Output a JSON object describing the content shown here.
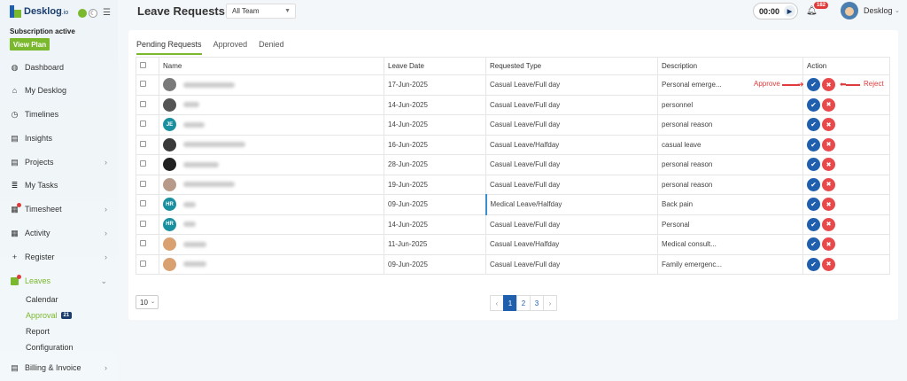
{
  "brand": {
    "name": "Desklog",
    "suffix": ".io"
  },
  "subscription": {
    "status": "Subscription active",
    "view_plan": "View Plan"
  },
  "sidebar": {
    "items": [
      {
        "label": "Dashboard",
        "icon": "palette-icon"
      },
      {
        "label": "My Desklog",
        "icon": "home-icon"
      },
      {
        "label": "Timelines",
        "icon": "clock-icon"
      },
      {
        "label": "Insights",
        "icon": "book-icon"
      },
      {
        "label": "Projects",
        "icon": "book-icon"
      },
      {
        "label": "My Tasks",
        "icon": "list-icon"
      },
      {
        "label": "Timesheet",
        "icon": "calendar-icon"
      },
      {
        "label": "Activity",
        "icon": "grid-icon"
      },
      {
        "label": "Register",
        "icon": "plus-icon"
      },
      {
        "label": "Leaves",
        "icon": "leaves-icon"
      },
      {
        "label": "Billing & Invoice",
        "icon": "invoice-icon"
      }
    ],
    "leaves_sub": [
      {
        "label": "Calendar"
      },
      {
        "label": "Approval",
        "badge": "21"
      },
      {
        "label": "Report"
      },
      {
        "label": "Configuration"
      }
    ]
  },
  "header": {
    "title": "Leave Requests",
    "team_filter": "All Team",
    "timer": "00:00",
    "notifications": "182",
    "user": "Desklog"
  },
  "tabs": [
    "Pending Requests",
    "Approved",
    "Denied"
  ],
  "table": {
    "columns": [
      "Name",
      "Leave Date",
      "Requested Type",
      "Description",
      "Action"
    ],
    "rows": [
      {
        "avatar": "photo",
        "initials": "",
        "color": "#7a7a7a",
        "date": "17-Jun-2025",
        "type": "Casual Leave/Full day",
        "medical": false,
        "desc": "Personal emerge..."
      },
      {
        "avatar": "photo",
        "initials": "",
        "color": "#555555",
        "date": "14-Jun-2025",
        "type": "Casual Leave/Full day",
        "medical": false,
        "desc": "personnel"
      },
      {
        "avatar": "initials",
        "initials": "JE",
        "color": "#1a8fa0",
        "date": "14-Jun-2025",
        "type": "Casual Leave/Full day",
        "medical": false,
        "desc": "personal reason"
      },
      {
        "avatar": "photo",
        "initials": "",
        "color": "#3a3a3a",
        "date": "16-Jun-2025",
        "type": "Casual Leave/Halfday",
        "medical": false,
        "desc": "casual leave"
      },
      {
        "avatar": "photo",
        "initials": "",
        "color": "#222222",
        "date": "28-Jun-2025",
        "type": "Casual Leave/Full day",
        "medical": false,
        "desc": "personal reason"
      },
      {
        "avatar": "photo",
        "initials": "",
        "color": "#b89a8a",
        "date": "19-Jun-2025",
        "type": "Casual Leave/Full day",
        "medical": false,
        "desc": "personal reason"
      },
      {
        "avatar": "initials",
        "initials": "HR",
        "color": "#1a8fa0",
        "date": "09-Jun-2025",
        "type": "Medical Leave/Halfday",
        "medical": true,
        "desc": "Back pain"
      },
      {
        "avatar": "initials",
        "initials": "HR",
        "color": "#1a8fa0",
        "date": "14-Jun-2025",
        "type": "Casual Leave/Full day",
        "medical": false,
        "desc": "Personal"
      },
      {
        "avatar": "photo",
        "initials": "",
        "color": "#d9a070",
        "date": "11-Jun-2025",
        "type": "Casual Leave/Halfday",
        "medical": false,
        "desc": "Medical consult..."
      },
      {
        "avatar": "photo",
        "initials": "",
        "color": "#d9a070",
        "date": "09-Jun-2025",
        "type": "Casual Leave/Full day",
        "medical": false,
        "desc": "Family emergenc..."
      }
    ]
  },
  "annotations": {
    "approve": "Approve",
    "reject": "Reject"
  },
  "pagination": {
    "per_page": "10",
    "prev": "‹",
    "next": "›",
    "pages": [
      "1",
      "2",
      "3"
    ],
    "current": "1"
  },
  "colors": {
    "accent": "#7ab82e",
    "primary": "#1f5fae",
    "danger": "#e8494a"
  }
}
